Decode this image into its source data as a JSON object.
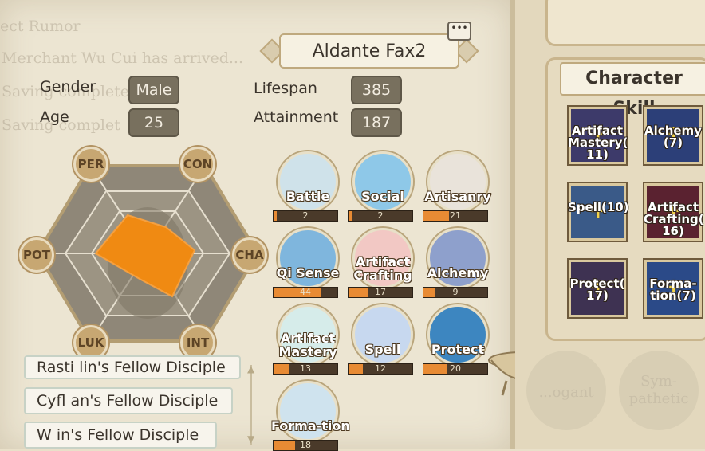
{
  "header": {
    "character_name": "Aldante Fax2",
    "chat_icon": "speech-bubble-icon"
  },
  "background_log": [
    "ect Rumor",
    "Merchant Wu Cui has arrived...",
    "Saving complete",
    "Saving complet"
  ],
  "info": {
    "gender_label": "Gender",
    "gender_value": "Male",
    "age_label": "Age",
    "age_value": "25",
    "lifespan_label": "Lifespan",
    "lifespan_value": "385",
    "attainment_label": "Attainment",
    "attainment_value": "187"
  },
  "hexagon": {
    "labels": {
      "per": "PER",
      "con": "CON",
      "cha": "CHA",
      "int": "INT",
      "luk": "LUK",
      "pot": "POT"
    },
    "fill_color": "#f08a12"
  },
  "skills": [
    {
      "name": "Battle",
      "value": "2",
      "level": 0.05,
      "icon": "crystal-pillar-icon"
    },
    {
      "name": "Social",
      "value": "2",
      "level": 0.05,
      "icon": "chat-bubble-icon"
    },
    {
      "name": "Artisanry",
      "value": "21",
      "level": 0.4,
      "icon": "brush-icon"
    },
    {
      "name": "Qi Sense",
      "value": "44",
      "level": 0.75,
      "icon": "yin-yang-icon"
    },
    {
      "name": "Artifact Crafting",
      "value": "17",
      "level": 0.3,
      "icon": "flame-icon"
    },
    {
      "name": "Alchemy",
      "value": "9",
      "level": 0.18,
      "icon": "cauldron-icon"
    },
    {
      "name": "Artifact Mastery",
      "value": "13",
      "level": 0.25,
      "icon": "sword-icon"
    },
    {
      "name": "Spell",
      "value": "12",
      "level": 0.22,
      "icon": "swirl-icon"
    },
    {
      "name": "Protect",
      "value": "20",
      "level": 0.38,
      "icon": "shield-icon"
    },
    {
      "name": "Forma-tion",
      "value": "18",
      "level": 0.34,
      "icon": "formation-icon"
    }
  ],
  "disciples": [
    "Rasti lin's  Fellow Disciple",
    "Cyfl an's  Fellow Disciple",
    "W in's  Fellow Disciple"
  ],
  "character_skill": {
    "title": "Character Skill",
    "cards": [
      {
        "label": "Artifact Mastery( 11)",
        "icon": "sword-icon"
      },
      {
        "label": "Alchemy (7)",
        "icon": "cauldron-icon"
      },
      {
        "label": "Spell(10)",
        "icon": "swirl-icon"
      },
      {
        "label": "Artifact Crafting( 16)",
        "icon": "flame-icon"
      },
      {
        "label": "Protect( 17)",
        "icon": "shield-icon"
      },
      {
        "label": "Forma- tion(7)",
        "icon": "formation-icon"
      }
    ]
  },
  "bottom_right": {
    "left_button": "...ogant",
    "right_button": "Sym- pathetic"
  }
}
